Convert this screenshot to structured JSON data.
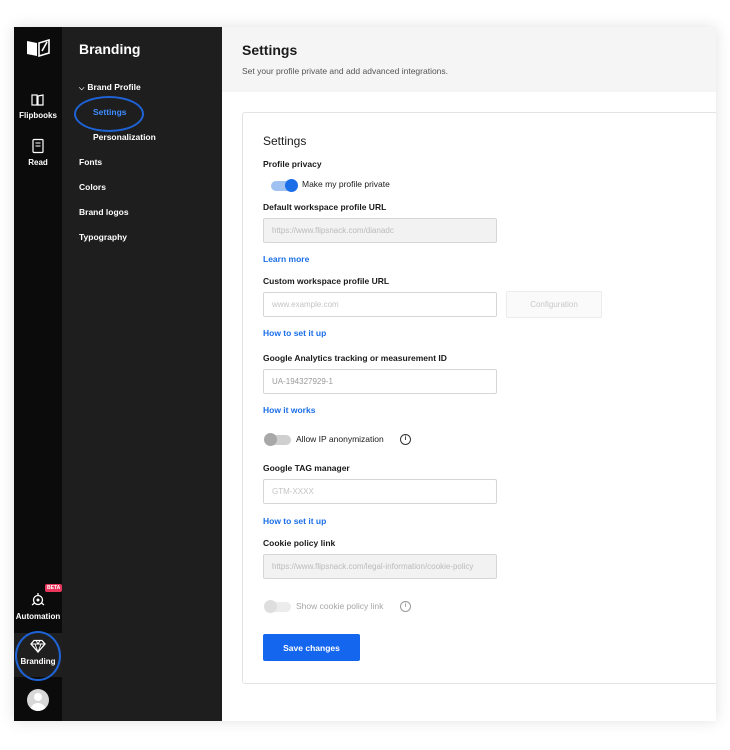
{
  "rail": {
    "items": [
      {
        "label": "Flipbooks",
        "icon": "flipbooks-icon"
      },
      {
        "label": "Read",
        "icon": "read-icon"
      },
      {
        "label": "Automation",
        "icon": "automation-icon",
        "badge": "BETA"
      },
      {
        "label": "Branding",
        "icon": "diamond-icon"
      }
    ]
  },
  "sidebar": {
    "title": "Branding",
    "items": [
      {
        "label": "Brand Profile",
        "icon": "chevron-down-icon"
      },
      {
        "label": "Settings",
        "active": true
      },
      {
        "label": "Personalization"
      },
      {
        "label": "Fonts"
      },
      {
        "label": "Colors"
      },
      {
        "label": "Brand logos"
      },
      {
        "label": "Typography"
      }
    ]
  },
  "header": {
    "title": "Settings",
    "subtitle": "Set your profile private and add advanced integrations."
  },
  "card": {
    "title": "Settings",
    "privacy_label": "Profile privacy",
    "privacy_toggle_label": "Make my profile private",
    "privacy_on": true,
    "default_url_label": "Default workspace profile URL",
    "default_url_value": "https://www.flipsnack.com/dianadc",
    "learn_more": "Learn more",
    "custom_url_label": "Custom workspace profile URL",
    "custom_url_placeholder": "www.example.com",
    "configuration_button": "Configuration",
    "how_set_1": "How to set it up",
    "ga_label": "Google Analytics tracking or measurement ID",
    "ga_value": "UA-194327929-1",
    "how_works": "How it works",
    "ip_label": "Allow IP anonymization",
    "gtm_label": "Google TAG manager",
    "gtm_placeholder": "GTM-XXXX",
    "how_set_2": "How to set it up",
    "cookie_label": "Cookie policy link",
    "cookie_value": "https://www.flipsnack.com/legal-information/cookie-policy",
    "show_cookie_label": "Show cookie policy link",
    "save_button": "Save changes"
  },
  "colors": {
    "accent": "#1566ee",
    "rail_bg": "#0b0b0b",
    "sidebar_bg": "#1e1e1e",
    "active_link": "#3e8bff",
    "annotation": "#1e63d6"
  }
}
